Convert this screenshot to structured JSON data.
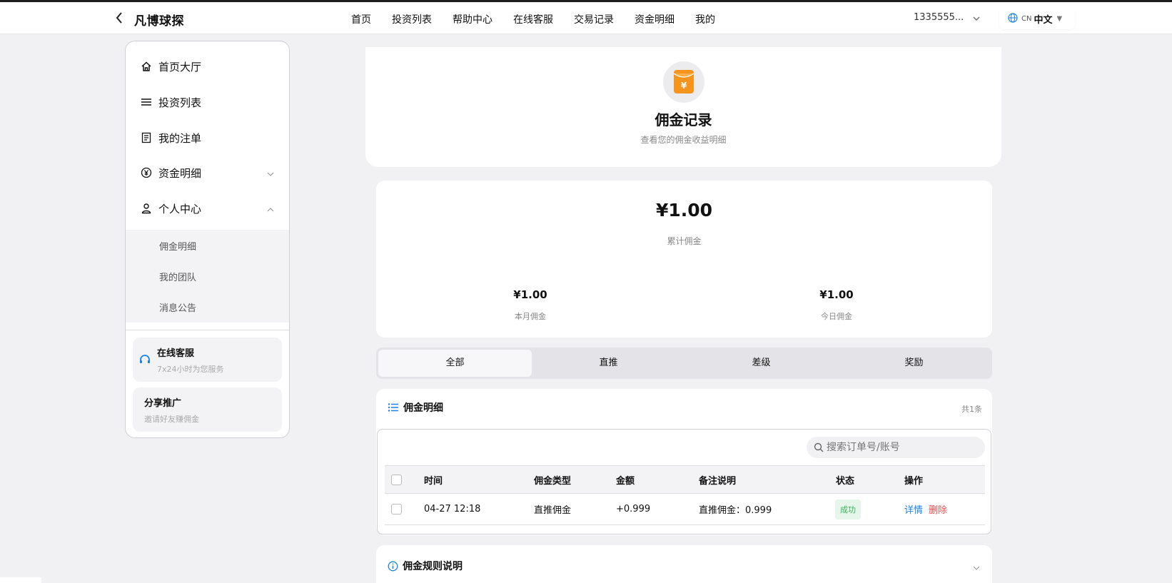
{
  "header": {
    "brand": "凡博球探",
    "nav": [
      "首页",
      "投资列表",
      "帮助中心",
      "在线客服",
      "交易记录",
      "资金明细",
      "我的"
    ],
    "account": "1335555...",
    "lang_code": "CN",
    "lang_label": "中文"
  },
  "sidebar": {
    "items": [
      {
        "label": "首页大厅",
        "icon": "home-icon"
      },
      {
        "label": "投资列表",
        "icon": "list-icon"
      },
      {
        "label": "我的注单",
        "icon": "document-icon"
      },
      {
        "label": "资金明细",
        "icon": "yuan-icon"
      },
      {
        "label": "个人中心",
        "icon": "user-icon"
      }
    ],
    "subitems": [
      "佣金明细",
      "我的团队",
      "消息公告"
    ],
    "support": {
      "title": "在线客服",
      "subtitle": "7x24小时为您服务"
    },
    "share": {
      "title": "分享推广",
      "subtitle": "邀请好友赚佣金"
    }
  },
  "hero": {
    "title": "佣金记录",
    "subtitle": "查看您的佣金收益明细"
  },
  "stats": {
    "total": "¥1.00",
    "total_label": "累计佣金",
    "month": "¥1.00",
    "month_label": "本月佣金",
    "today": "¥1.00",
    "today_label": "今日佣金"
  },
  "tabs": [
    "全部",
    "直推",
    "差级",
    "奖励"
  ],
  "detail": {
    "title": "佣金明细",
    "count": "共1条",
    "search_placeholder": "搜索订单号/账号",
    "columns": [
      "时间",
      "佣金类型",
      "金额",
      "备注说明",
      "状态",
      "操作"
    ],
    "rows": [
      {
        "time": "04-27 12:18",
        "type": "直推佣金",
        "amount": "+0.999",
        "note": "直推佣金：0.999",
        "status": "成功",
        "action_detail": "详情",
        "action_delete": "删除"
      }
    ]
  },
  "rules": {
    "title": "佣金规则说明"
  },
  "colors": {
    "accent_blue": "#1a82e6",
    "orange": "#f7941d",
    "success_green": "#3bb35a",
    "delete_red": "#ef5350"
  }
}
